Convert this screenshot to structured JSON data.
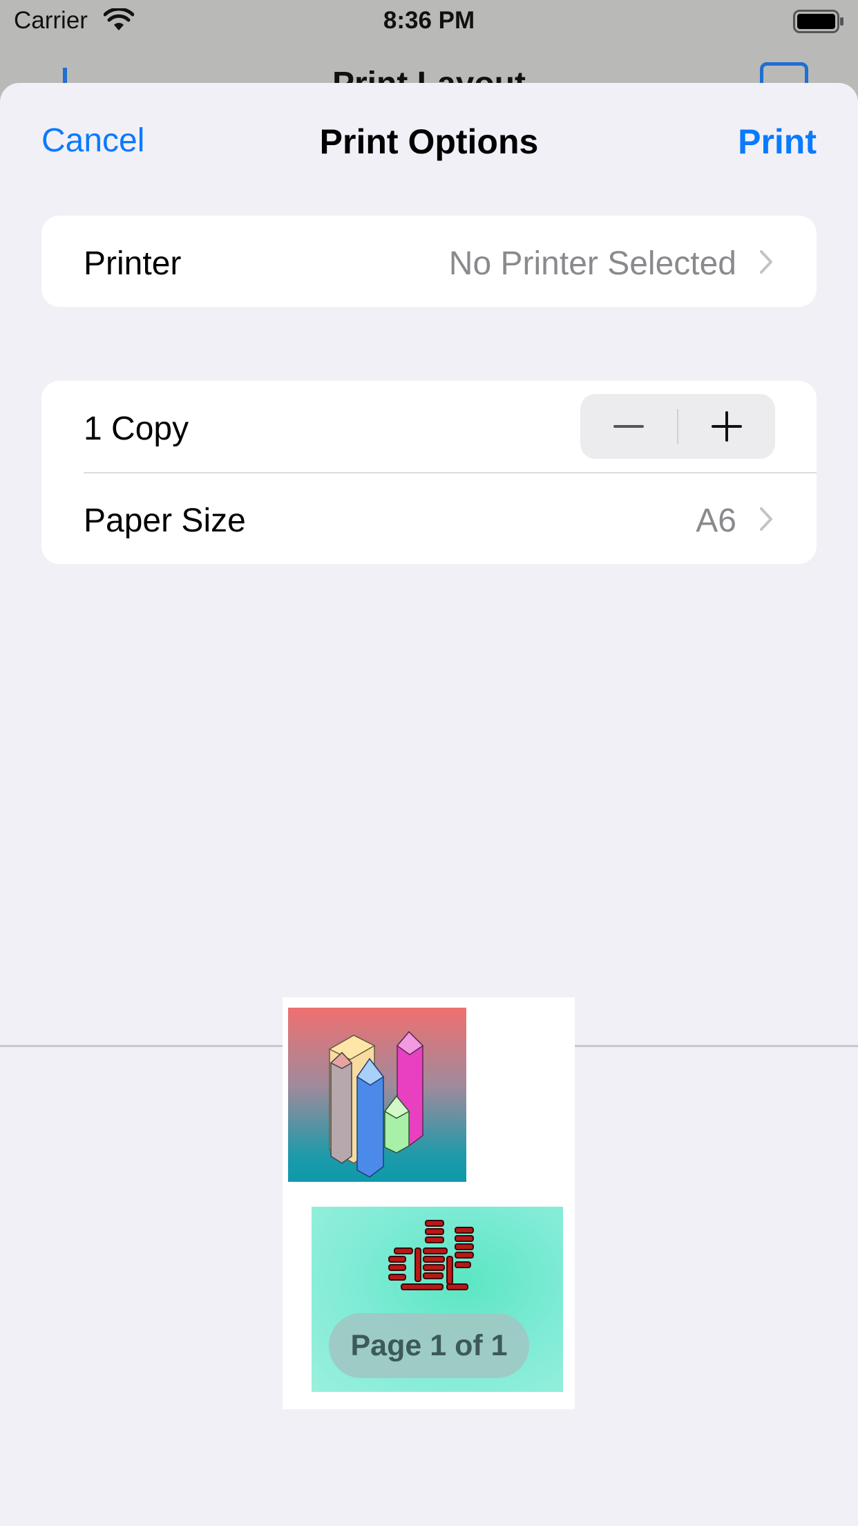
{
  "status_bar": {
    "carrier": "Carrier",
    "time": "8:36 PM",
    "icons": [
      "wifi-icon",
      "battery-icon"
    ]
  },
  "background_nav": {
    "title": "Print Layout",
    "accent": "#1f6fd1"
  },
  "sheet": {
    "title": "Print Options",
    "cancel_label": "Cancel",
    "print_label": "Print",
    "accent": "#0a7aff"
  },
  "printer_row": {
    "label": "Printer",
    "value": "No Printer Selected"
  },
  "copies_row": {
    "label": "1 Copy",
    "copies": 1
  },
  "paper_row": {
    "label": "Paper Size",
    "value": "A6"
  },
  "preview": {
    "page_indicator": "Page 1 of 1"
  }
}
